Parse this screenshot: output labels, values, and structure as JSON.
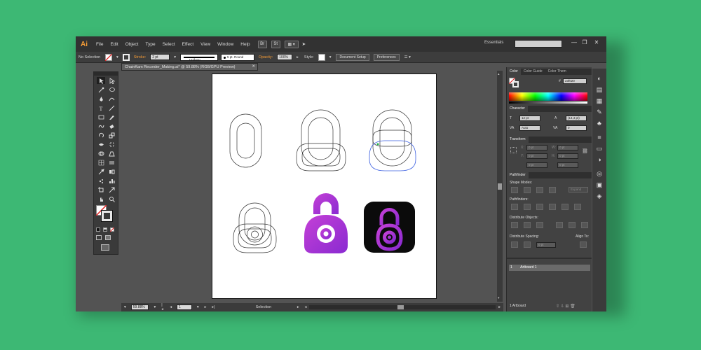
{
  "app": {
    "logo": "Ai",
    "menus": [
      "File",
      "Edit",
      "Object",
      "Type",
      "Select",
      "Effect",
      "View",
      "Window",
      "Help"
    ],
    "menu_buttons": [
      "Br",
      "St",
      "▦ ▾",
      "➤"
    ],
    "workspace": "Essentials",
    "window_controls": [
      "—",
      "❐",
      "✕"
    ],
    "accent": "#f39b36"
  },
  "control_bar": {
    "selection": "No Selection",
    "stroke_label": "Stroke:",
    "stroke_weight": "2 pt",
    "profile": "Uniform",
    "brush": "5 pt. Round",
    "opacity_label": "Opacity:",
    "opacity": "100%",
    "style_label": "Style:",
    "document_setup": "Document Setup",
    "preferences": "Preferences"
  },
  "document": {
    "tab_title": "ChainKam Recorder_Making.ai* @ 59.88% (RGB/GPU Preview)",
    "zoom": "59.88%",
    "artboard_number": "1",
    "status_tool": "Selection"
  },
  "panels": {
    "color_tabs": [
      "Color",
      "Color Guide",
      "Color Them"
    ],
    "hex_value": "23f020",
    "character_tab": "Character",
    "font_size": "12 pt",
    "leading": "(14,4 pt)",
    "tracking_auto": "Auto",
    "tracking": "0",
    "transform_tab": "Transform",
    "x_label": "X:",
    "y_label": "Y:",
    "w_label": "W:",
    "h_label": "H:",
    "x": "0 pt",
    "y": "0 pt",
    "w": "0 pt",
    "h": "0 pt",
    "x2": "0 pt",
    "y2": "0 pt",
    "pathfinder_tab": "Pathfinder",
    "shape_modes": "Shape Modes:",
    "expand": "Expand",
    "pathfinders": "Pathfinders:",
    "distribute_objects": "Distribute Objects:",
    "distribute_spacing": "Distribute Spacing:",
    "align_to": "Align To:",
    "spacing_value": "0 pt",
    "artboards": [
      {
        "num": "1",
        "name": "Artboard 1"
      }
    ],
    "artboard_footer": "1 Artboard"
  },
  "artwork": {
    "gradient_start": "#c440d6",
    "gradient_end": "#8a2ad1",
    "dark_bg": "#0b0b0b",
    "outline_color": "#333333",
    "selection_color": "#3a5ee0"
  }
}
